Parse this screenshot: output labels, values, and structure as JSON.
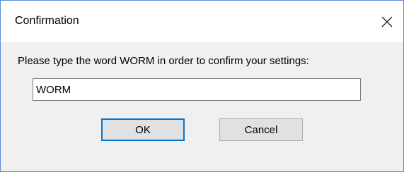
{
  "window": {
    "title": "Confirmation",
    "close_icon": "close-icon"
  },
  "form": {
    "prompt": "Please type the word WORM in order to confirm your settings:",
    "input_value": "WORM"
  },
  "buttons": {
    "ok_label": "OK",
    "cancel_label": "Cancel"
  },
  "colors": {
    "accent_border": "#0078d7",
    "window_border": "#5a8fd6",
    "dialog_background": "#f0f0f0"
  }
}
